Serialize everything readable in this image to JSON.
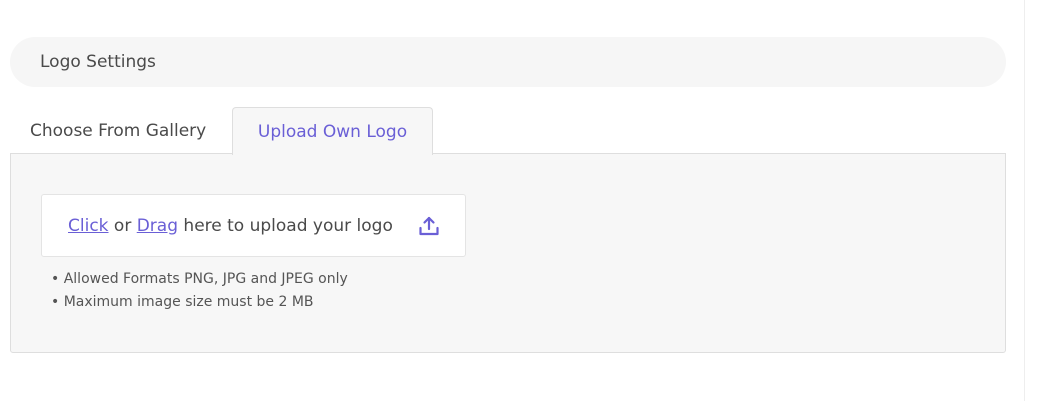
{
  "section": {
    "title": "Logo Settings"
  },
  "tabs": [
    {
      "label": "Choose From Gallery",
      "active": false
    },
    {
      "label": "Upload Own Logo",
      "active": true
    }
  ],
  "upload": {
    "click_label": "Click",
    "or_text": "or",
    "drag_label": "Drag",
    "rest_text": "here to upload your logo",
    "icon": "upload-icon"
  },
  "notes": [
    "• Allowed Formats PNG, JPG and JPEG only",
    "• Maximum image size must be 2 MB"
  ],
  "colors": {
    "accent": "#6a5fd6",
    "panel_bg": "#f7f7f7",
    "header_bg": "#f6f6f6",
    "text": "#4a4a4a"
  }
}
